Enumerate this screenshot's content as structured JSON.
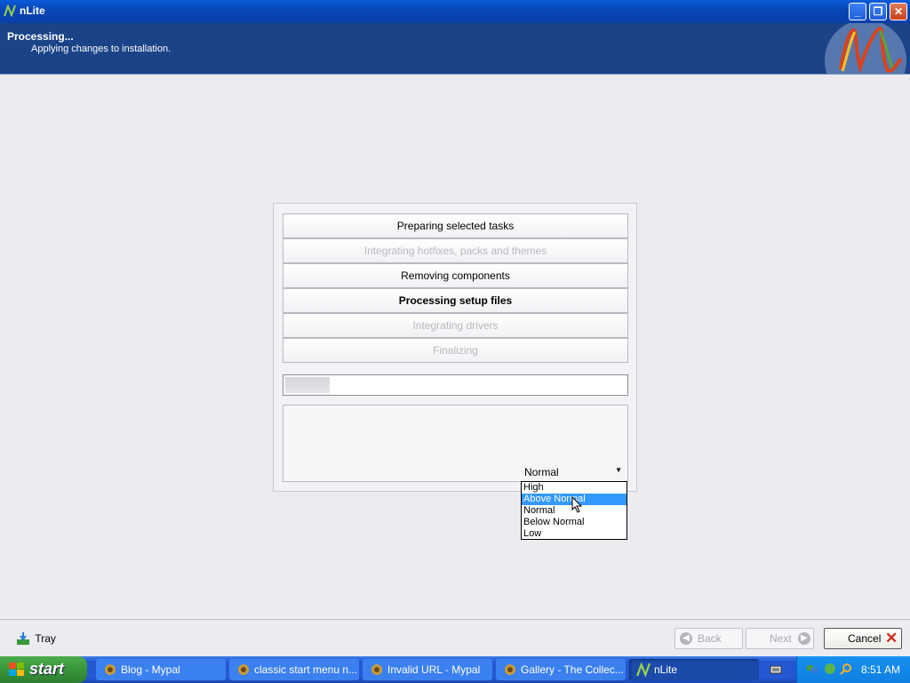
{
  "window": {
    "title": "nLite"
  },
  "header": {
    "title": "Processing...",
    "subtitle": "Applying changes to installation."
  },
  "steps": [
    {
      "label": "Preparing selected tasks",
      "state": "done"
    },
    {
      "label": "Integrating hotfixes, packs and themes",
      "state": "skipped"
    },
    {
      "label": "Removing components",
      "state": "done"
    },
    {
      "label": "Processing setup files",
      "state": "active"
    },
    {
      "label": "Integrating drivers",
      "state": "pending"
    },
    {
      "label": "Finalizing",
      "state": "pending"
    }
  ],
  "progress": {
    "fraction": 0.13
  },
  "priority": {
    "selected": "Normal",
    "options": [
      "High",
      "Above Normal",
      "Normal",
      "Below Normal",
      "Low"
    ],
    "highlighted": "Above Normal"
  },
  "footer": {
    "tray_label": "Tray",
    "back_label": "Back",
    "next_label": "Next",
    "cancel_label": "Cancel"
  },
  "taskbar": {
    "start_label": "start",
    "tasks": [
      {
        "label": "Blog - Mypal"
      },
      {
        "label": "classic start menu n..."
      },
      {
        "label": "Invalid URL - Mypal"
      },
      {
        "label": "Gallery - The Collec..."
      },
      {
        "label": "nLite"
      }
    ],
    "clock": "8:51 AM"
  },
  "colors": {
    "header_bg": "#1b4388",
    "selection": "#3399ff",
    "title_bar": "#0a5ad8"
  }
}
